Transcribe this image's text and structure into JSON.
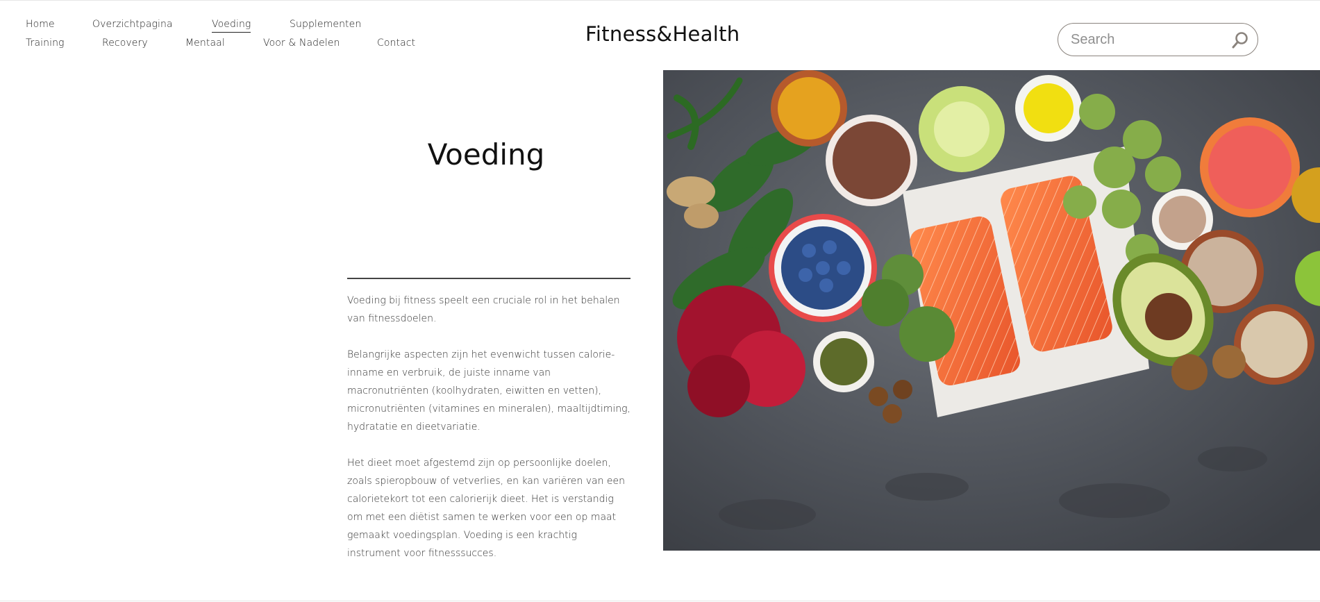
{
  "nav": {
    "items": [
      {
        "label": "Home"
      },
      {
        "label": "Overzichtpagina"
      },
      {
        "label": "Voeding",
        "active": true
      },
      {
        "label": "Supplementen"
      },
      {
        "label": "Training"
      },
      {
        "label": "Recovery"
      },
      {
        "label": "Mentaal"
      },
      {
        "label": "Voor & Nadelen"
      },
      {
        "label": "Contact"
      }
    ]
  },
  "header": {
    "logo_text": "Fitness&Health",
    "search_placeholder": "Search",
    "search_value": "",
    "search_icon": "search-icon"
  },
  "main": {
    "title": "Voeding",
    "paragraphs": [
      "Voeding bij fitness speelt een cruciale rol in het behalen van fitnessdoelen.",
      "Belangrijke aspecten zijn het evenwicht tussen calorie-inname en verbruik, de juiste inname van macronutriënten (koolhydraten, eiwitten en vetten), micronutriënten (vitamines en mineralen), maaltijdtiming, hydratatie en dieetvariatie.",
      "Het dieet moet afgestemd zijn op persoonlijke doelen, zoals spieropbouw of vetverlies, en kan variëren van een calorietekort tot een calorierijk dieet. Het is verstandig om met een diëtist samen te werken voor een op maat gemaakt voedingsplan. Voeding is een krachtig instrument voor fitnesssucces."
    ]
  },
  "colors": {
    "text": "#111111",
    "rule": "#444444",
    "search_border": "#8a837d",
    "background": "#ffffff",
    "hero_slate": "#55595f"
  }
}
